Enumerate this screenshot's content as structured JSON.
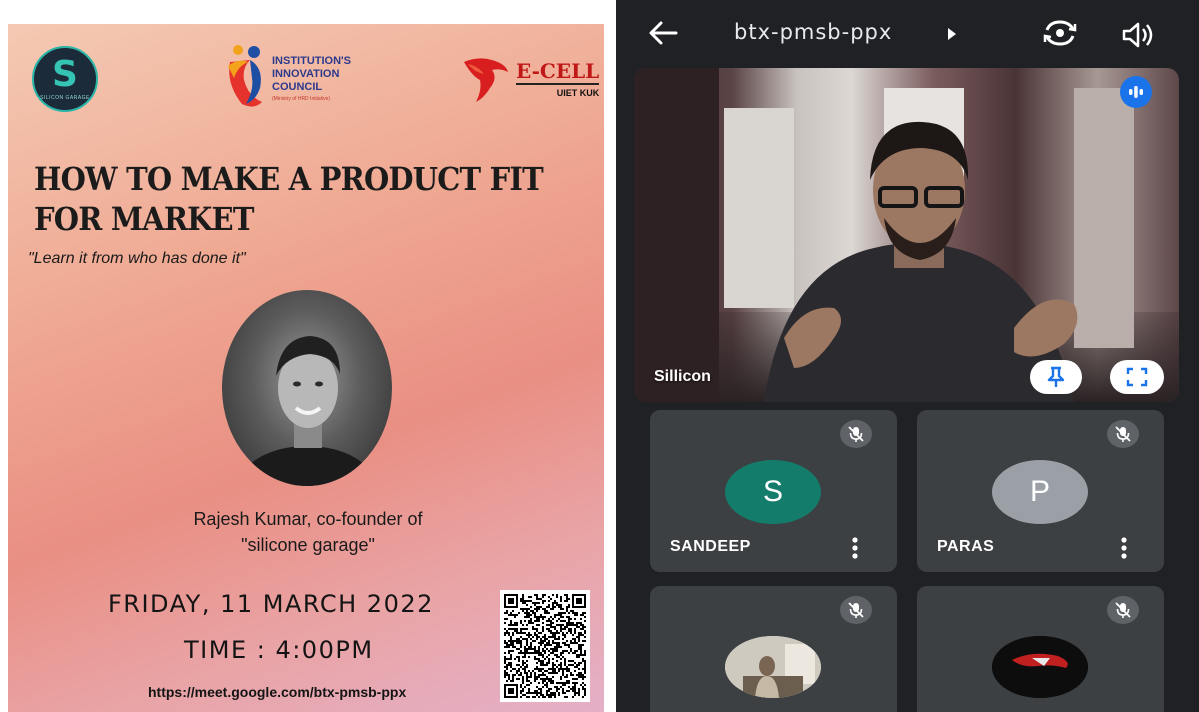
{
  "poster": {
    "logo_left_caption": "SILICON GARAGE",
    "iic": {
      "line1": "INSTITUTION'S",
      "line2": "INNOVATION",
      "line3": "COUNCIL",
      "sub": "(Ministry of HRD Initiative)"
    },
    "ecell": {
      "title": "E-CELL",
      "sub": "UIET KUK"
    },
    "title": "HOW TO MAKE A PRODUCT FIT FOR MARKET",
    "tagline": "\"Learn it from who has done it\"",
    "speaker_line1": "Rajesh Kumar, co-founder of",
    "speaker_line2": "\"silicone garage\"",
    "date": "FRIDAY, 11 MARCH 2022",
    "time": "TIME : 4:00PM",
    "link": "https://meet.google.com/btx-pmsb-ppx"
  },
  "meet": {
    "meeting_code": "btx-pmsb-ppx",
    "main_tile": {
      "name": "Sillicon"
    },
    "participants": [
      {
        "name": "SANDEEP",
        "initial": "S",
        "avatar_color": "#137c6b"
      },
      {
        "name": "PARAS",
        "initial": "P",
        "avatar_color": "#9aa0a6"
      }
    ]
  }
}
